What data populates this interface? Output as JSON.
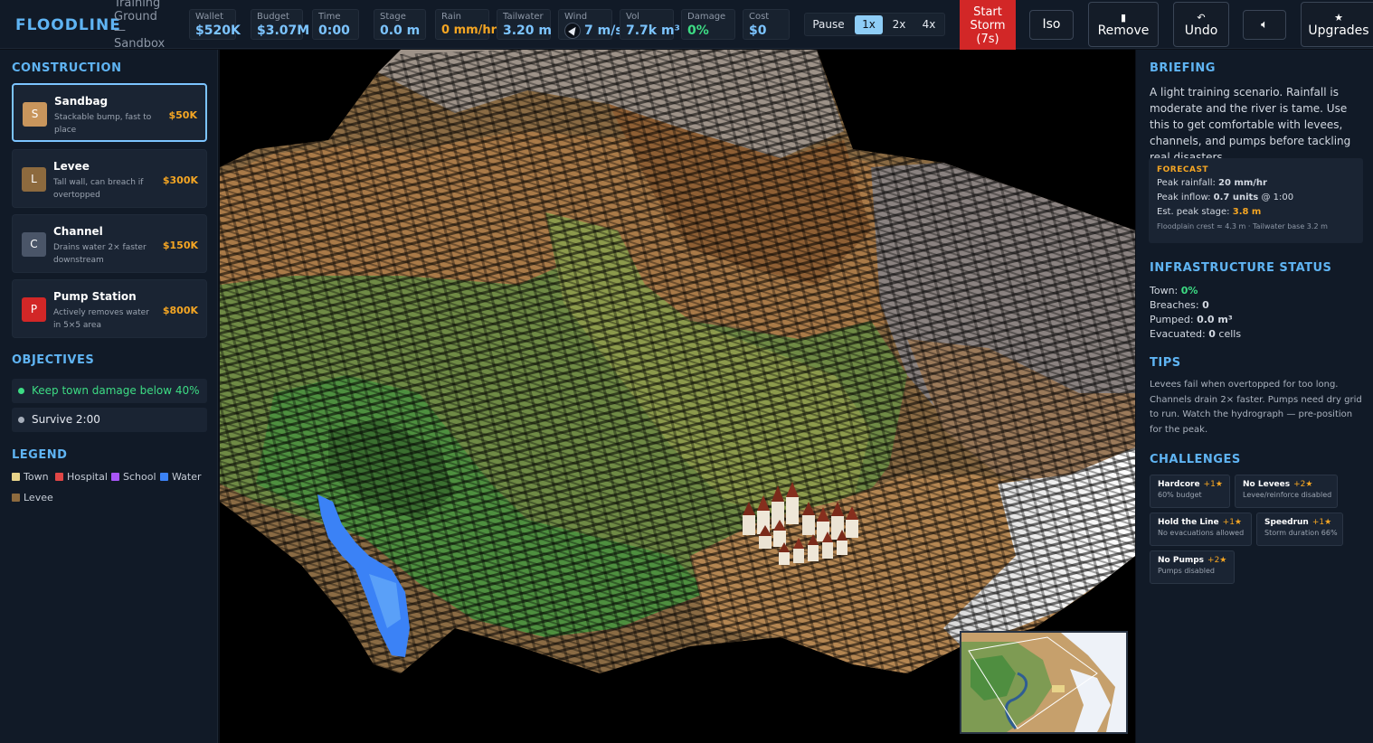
{
  "app": {
    "logo": "FLOODLINE",
    "scenario_name": "Training Ground — Sandbox"
  },
  "stats": {
    "wallet": {
      "label": "Wallet",
      "value": "$520K"
    },
    "budget": {
      "label": "Budget",
      "value": "$3.07M"
    },
    "time": {
      "label": "Time",
      "value": "0:00"
    },
    "stage": {
      "label": "Stage",
      "value": "0.0 m"
    },
    "rain": {
      "label": "Rain",
      "value": "0 mm/hr"
    },
    "tailwater": {
      "label": "Tailwater",
      "value": "3.20 m"
    },
    "wind": {
      "label": "Wind",
      "value": "7 m/s"
    },
    "vol": {
      "label": "Vol",
      "value": "7.7k m³"
    },
    "damage": {
      "label": "Damage",
      "value": "0%"
    },
    "cost": {
      "label": "Cost",
      "value": "$0"
    }
  },
  "controls": {
    "pause": "Pause",
    "speeds": [
      "1x",
      "2x",
      "4x"
    ],
    "active_speed": "1x",
    "start_storm": "Start Storm (7s)",
    "iso": "Iso",
    "remove": "Remove",
    "undo": "Undo",
    "sound_icon": "speaker-icon",
    "upgrades": "Upgrades"
  },
  "construction": {
    "title": "CONSTRUCTION",
    "items": [
      {
        "letter": "S",
        "name": "Sandbag",
        "desc": "Stackable bump, fast to place",
        "price": "$50K",
        "color": "#c8955c",
        "selected": true
      },
      {
        "letter": "L",
        "name": "Levee",
        "desc": "Tall wall, can breach if overtopped",
        "price": "$300K",
        "color": "#8d6a3e",
        "selected": false
      },
      {
        "letter": "C",
        "name": "Channel",
        "desc": "Drains water 2× faster downstream",
        "price": "$150K",
        "color": "#4a5568",
        "selected": false
      },
      {
        "letter": "P",
        "name": "Pump Station",
        "desc": "Actively removes water in 5×5 area",
        "price": "$800K",
        "color": "#d22727",
        "selected": false
      }
    ]
  },
  "objectives": {
    "title": "OBJECTIVES",
    "items": [
      {
        "text": "Keep town damage below 40%",
        "color": "#3ddc84"
      },
      {
        "text": "Survive 2:00",
        "color": "#8d97a6"
      }
    ]
  },
  "legend": {
    "title": "LEGEND",
    "items": [
      {
        "label": "Town",
        "color": "#e8d48a"
      },
      {
        "label": "Hospital",
        "color": "#e04646"
      },
      {
        "label": "School",
        "color": "#a855f7"
      },
      {
        "label": "Water",
        "color": "#3b82f6"
      },
      {
        "label": "Levee",
        "color": "#8d6a3e"
      }
    ]
  },
  "briefing": {
    "title": "BRIEFING",
    "text": "A light training scenario. Rainfall is moderate and the river is tame. Use this to get comfortable with levees, channels, and pumps before tackling real disasters.",
    "forecast": {
      "title": "FORECAST",
      "peak_rainfall_label": "Peak rainfall:",
      "peak_rainfall": "20 mm/hr",
      "peak_inflow_label": "Peak inflow:",
      "peak_inflow": "0.7 units",
      "peak_inflow_time": "@ 1:00",
      "est_stage_label": "Est. peak stage:",
      "est_stage": "3.8 m",
      "footnote": "Floodplain crest ≈ 4.3 m · Tailwater base 3.2 m"
    }
  },
  "infrastructure": {
    "title": "INFRASTRUCTURE STATUS",
    "town_label": "Town:",
    "town": "0%",
    "breaches_label": "Breaches:",
    "breaches": "0",
    "pumped_label": "Pumped:",
    "pumped": "0.0 m³",
    "evacuated_label": "Evacuated:",
    "evacuated": "0",
    "evacuated_unit": "cells"
  },
  "tips": {
    "title": "TIPS",
    "text": "Levees fail when overtopped for too long. Channels drain 2× faster. Pumps need dry grid to run. Watch the hydrograph — pre-position for the peak."
  },
  "challenges": {
    "title": "CHALLENGES",
    "items": [
      {
        "name": "Hardcore",
        "stars": "+1★",
        "desc": "60% budget"
      },
      {
        "name": "No Levees",
        "stars": "+2★",
        "desc": "Levee/reinforce disabled"
      },
      {
        "name": "Hold the Line",
        "stars": "+1★",
        "desc": "No evacuations allowed"
      },
      {
        "name": "Speedrun",
        "stars": "+1★",
        "desc": "Storm duration 66%"
      },
      {
        "name": "No Pumps",
        "stars": "+2★",
        "desc": "Pumps disabled"
      }
    ]
  }
}
